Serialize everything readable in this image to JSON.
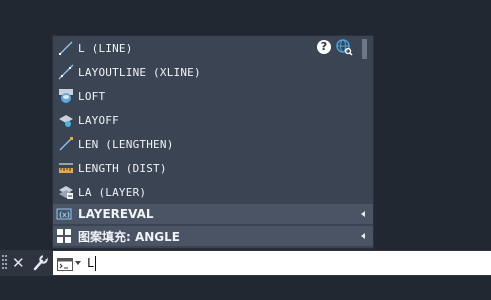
{
  "autocomplete": {
    "items": [
      {
        "label": "L (LINE)",
        "icon": "line-icon"
      },
      {
        "label": "LAYOUTLINE (XLINE)",
        "icon": "xline-icon"
      },
      {
        "label": "LOFT",
        "icon": "loft-icon"
      },
      {
        "label": "LAYOFF",
        "icon": "layoff-icon"
      },
      {
        "label": "LEN (LENGTHEN)",
        "icon": "lengthen-icon"
      },
      {
        "label": "LENGTH (DIST)",
        "icon": "dist-icon"
      },
      {
        "label": "LA (LAYER)",
        "icon": "layer-icon"
      }
    ],
    "submenus": [
      {
        "label": "LAYEREVAL",
        "icon": "system-variable-icon"
      },
      {
        "label": "图案填充: ANGLE",
        "icon": "hatch-icon"
      }
    ],
    "help_symbol": "?",
    "help_icon": "question-icon",
    "globe_icon": "globe-search-icon"
  },
  "command_line": {
    "close_symbol": "✕",
    "input_value": "L",
    "prompt_icon": "command-prompt-icon"
  },
  "colors": {
    "background": "#212832",
    "popup": "#3b4453",
    "submenu": "#4a5465",
    "accent_blue": "#4aa3df"
  }
}
